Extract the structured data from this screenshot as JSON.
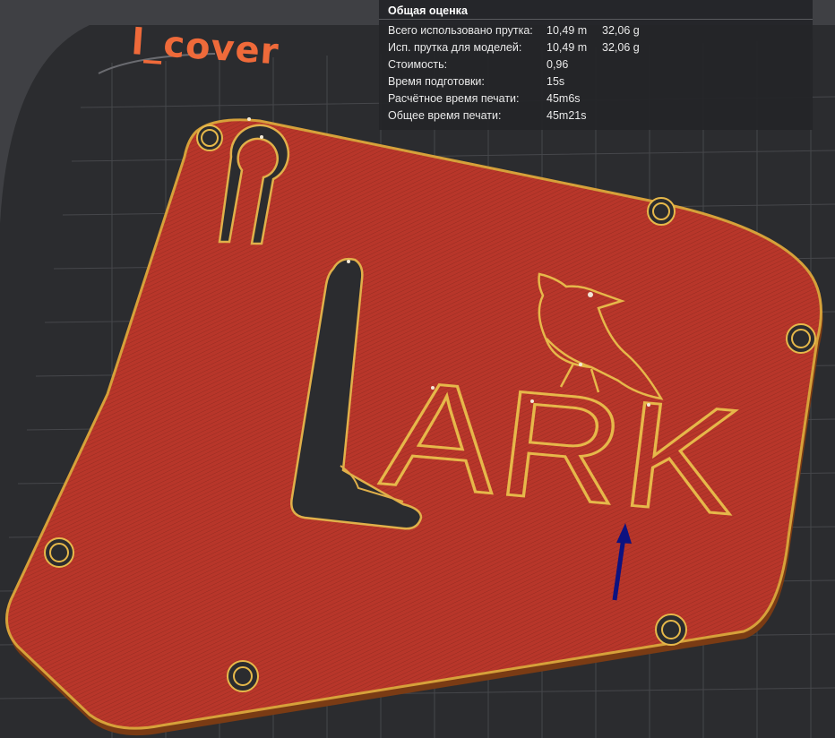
{
  "scene": {
    "plate_name": "l_cover",
    "model_text": "ARK",
    "colors": {
      "background": "#3f4044",
      "bed": "#2b2c2f",
      "bed_grid": "#46474b",
      "infill": "#b8362a",
      "perimeter": "#d6a13a",
      "plate_name": "#ef6a3a",
      "arrow": "#0d1280"
    }
  },
  "stats": {
    "title": "Общая оценка",
    "rows": [
      {
        "label": "Всего использовано прутка:",
        "value": "10,49 m",
        "value2": "32,06 g"
      },
      {
        "label": "Исп. прутка для моделей:",
        "value": "10,49 m",
        "value2": "32,06 g"
      },
      {
        "label": "Стоимость:",
        "value": "0,96",
        "value2": ""
      },
      {
        "label": "Время подготовки:",
        "value": "15s",
        "value2": ""
      },
      {
        "label": "Расчётное время печати:",
        "value": "45m6s",
        "value2": ""
      },
      {
        "label": "Общее время печати:",
        "value": "45m21s",
        "value2": ""
      }
    ]
  }
}
